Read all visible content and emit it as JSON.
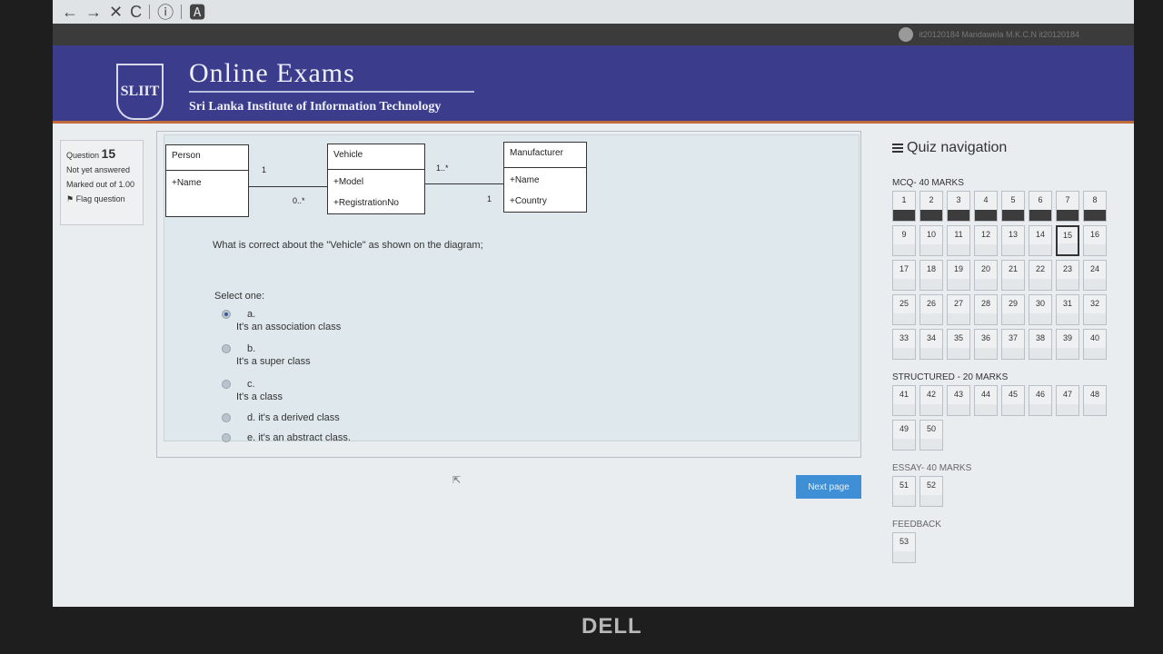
{
  "browser": {
    "nav": [
      "←",
      "→",
      "✕",
      "C",
      "ⓘ",
      "🅰"
    ]
  },
  "user": {
    "text": "it20120184 Mandawela M.K.C.N it20120184"
  },
  "header": {
    "title": "Online Exams",
    "subtitle": "Sri Lanka Institute of Information Technology",
    "logo_text": "SLIIT"
  },
  "question_info": {
    "label": "Question",
    "number": "15",
    "status": "Not yet answered",
    "marks": "Marked out of 1.00",
    "flag": "Flag question"
  },
  "diagram": {
    "person": {
      "name": "Person",
      "attrs": [
        "+Name"
      ]
    },
    "vehicle": {
      "name": "Vehicle",
      "attrs": [
        "+Model",
        "+RegistrationNo"
      ]
    },
    "manufacturer": {
      "name": "Manufacturer",
      "attrs": [
        "+Name",
        "+Country"
      ]
    },
    "mult": {
      "p_one": "1",
      "v_many": "0..*",
      "v_one_many": "1..*",
      "m_one": "1"
    }
  },
  "question": {
    "text": "What is correct about the \"Vehicle\" as shown on the diagram;",
    "select": "Select one:"
  },
  "options": [
    {
      "letter": "a.",
      "text": "It's an association class"
    },
    {
      "letter": "b.",
      "text": "It's a super class"
    },
    {
      "letter": "c.",
      "text": "It's a class"
    },
    {
      "letter": "",
      "text": "d. it's a derived class"
    },
    {
      "letter": "",
      "text": "e. it's an abstract class."
    }
  ],
  "next_button": "Next page",
  "nav": {
    "title": "Quiz navigation",
    "sections": [
      {
        "label": "MCQ- 40 MARKS",
        "items": [
          "1",
          "2",
          "3",
          "4",
          "5",
          "6",
          "7",
          "8",
          "9",
          "10",
          "11",
          "12",
          "13",
          "14",
          "15",
          "16",
          "17",
          "18",
          "19",
          "20",
          "21",
          "22",
          "23",
          "24",
          "25",
          "26",
          "27",
          "28",
          "29",
          "30",
          "31",
          "32",
          "33",
          "34",
          "35",
          "36",
          "37",
          "38",
          "39",
          "40"
        ]
      },
      {
        "label": "STRUCTURED - 20 MARKS",
        "items": [
          "41",
          "42",
          "43",
          "44",
          "45",
          "46",
          "47",
          "48",
          "49",
          "50"
        ]
      },
      {
        "label": "ESSAY- 40 MARKS",
        "items": [
          "51",
          "52"
        ]
      },
      {
        "label": "FEEDBACK",
        "items": [
          "53"
        ]
      }
    ]
  },
  "footer": {
    "brand": "DELL"
  }
}
